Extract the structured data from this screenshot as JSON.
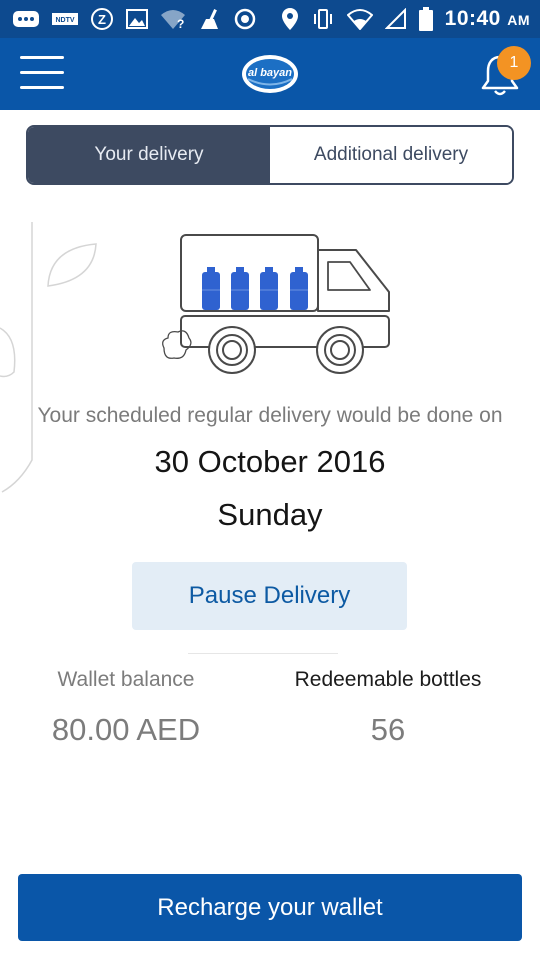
{
  "status_bar": {
    "time": "10:40",
    "ampm": "AM",
    "icons": [
      "notification-icon",
      "news-app-icon",
      "shazam-icon",
      "gallery-icon",
      "wifi-question-icon",
      "cleaner-icon",
      "radio-icon",
      "location-icon",
      "vibrate-icon",
      "wifi-icon",
      "cell-signal-icon",
      "battery-icon"
    ]
  },
  "app_bar": {
    "logo_text": "al bayan",
    "notification_count": "1"
  },
  "tabs": [
    {
      "label": "Your delivery",
      "active": true
    },
    {
      "label": "Additional delivery",
      "active": false
    }
  ],
  "schedule": {
    "text": "Your scheduled regular delivery would be done on",
    "date": "30 October 2016",
    "day": "Sunday"
  },
  "pause_button": "Pause Delivery",
  "wallet": {
    "label": "Wallet balance",
    "value": "80.00 AED"
  },
  "bottles": {
    "label": "Redeemable bottles",
    "value": "56"
  },
  "recharge_button": "Recharge your wallet",
  "colors": {
    "primary": "#0a56a8",
    "status_bar": "#0d4a8f",
    "tab_active": "#3d4a61",
    "badge": "#f39323",
    "bottle": "#2f62d0",
    "pause_bg": "#e3edf6"
  }
}
